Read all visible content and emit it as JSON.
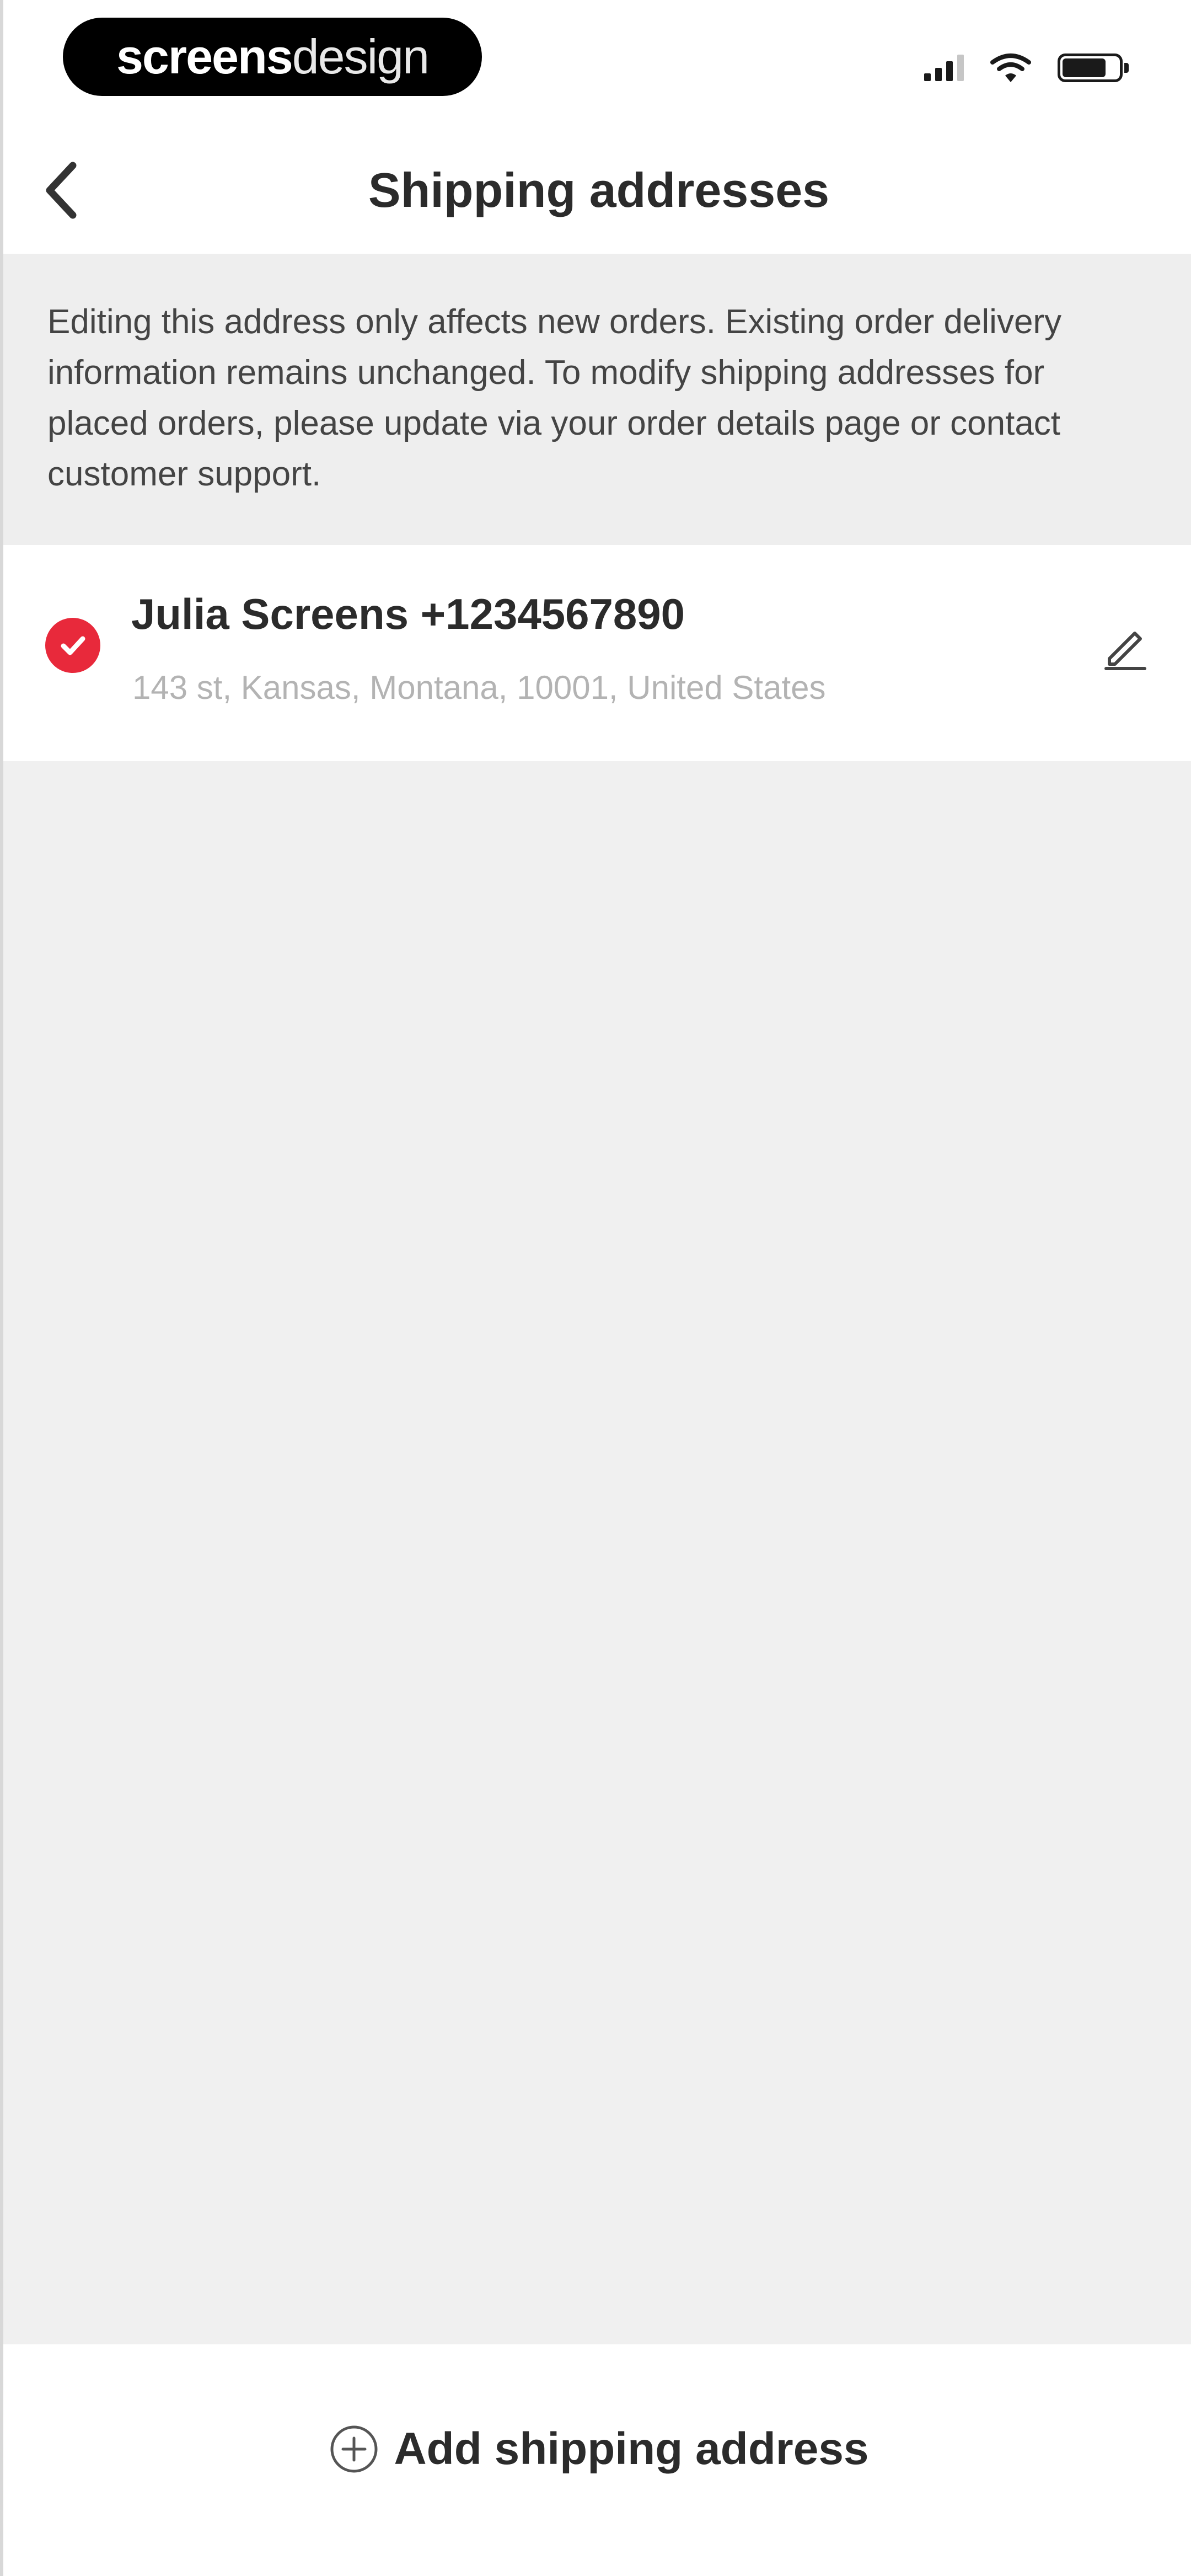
{
  "status_bar": {
    "brand_bold": "screens",
    "brand_light": "design",
    "icons": [
      "signal-icon",
      "wifi-icon",
      "battery-icon"
    ]
  },
  "header": {
    "title": "Shipping addresses",
    "back_icon": "chevron-left-icon"
  },
  "notice": {
    "text": "Editing this address only affects new orders. Existing order delivery information remains unchanged. To modify shipping addresses for placed orders, please update via your order details page or contact customer support."
  },
  "addresses": [
    {
      "name_phone": "Julia Screens +1234567890",
      "address": "143 st, Kansas, Montana, 10001, United States",
      "selected": true,
      "select_icon": "check-circle-icon",
      "edit_icon": "pencil-icon"
    }
  ],
  "footer": {
    "add_label": "Add shipping address",
    "add_icon": "plus-circle-icon"
  },
  "colors": {
    "accent": "#e8293b",
    "background": "#f0f0f0",
    "surface": "#ffffff",
    "text": "#2b2b2b",
    "muted": "#b3b3b3"
  }
}
